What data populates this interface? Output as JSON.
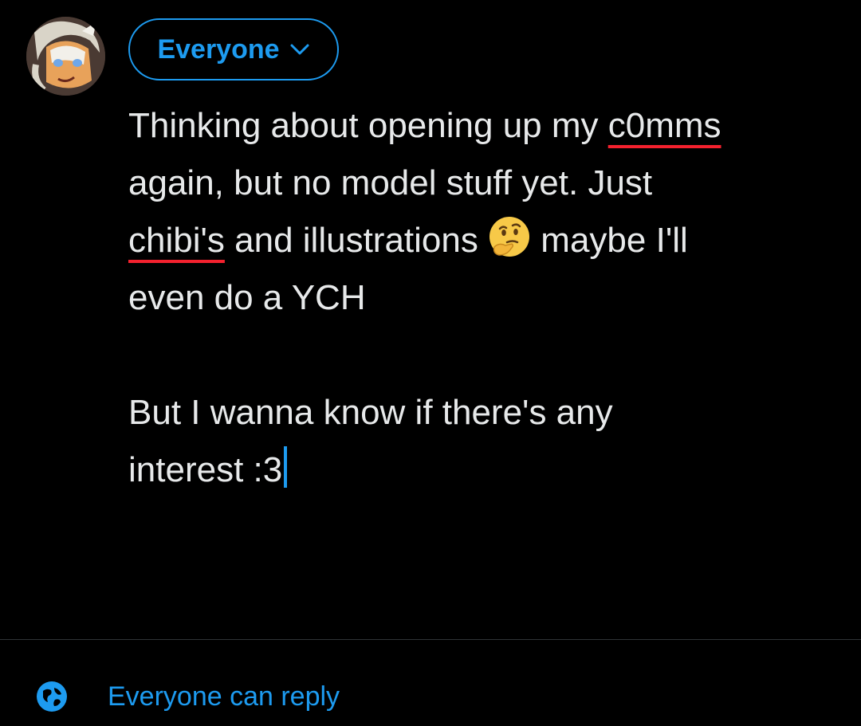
{
  "composer": {
    "audience_label": "Everyone",
    "lines": [
      [
        "Thinking about opening up my ",
        {
          "misspelled": "c0mms"
        }
      ],
      [
        "again, but no model stuff yet. Just"
      ],
      [
        {
          "misspelled": "chibi's"
        },
        " and illustrations ",
        {
          "emoji": "thinking-face"
        },
        " maybe I'll"
      ],
      [
        "even do a YCH"
      ],
      [],
      [
        "But I wanna know if there's any"
      ],
      [
        "interest :3",
        {
          "caret": true
        }
      ]
    ]
  },
  "reply_setting": {
    "icon": "globe-icon",
    "label": "Everyone can reply"
  },
  "colors": {
    "background": "#000000",
    "text": "#e7e9ea",
    "accent": "#1d9bf0",
    "spellcheck": "#f4212e",
    "divider": "#2f3336"
  }
}
